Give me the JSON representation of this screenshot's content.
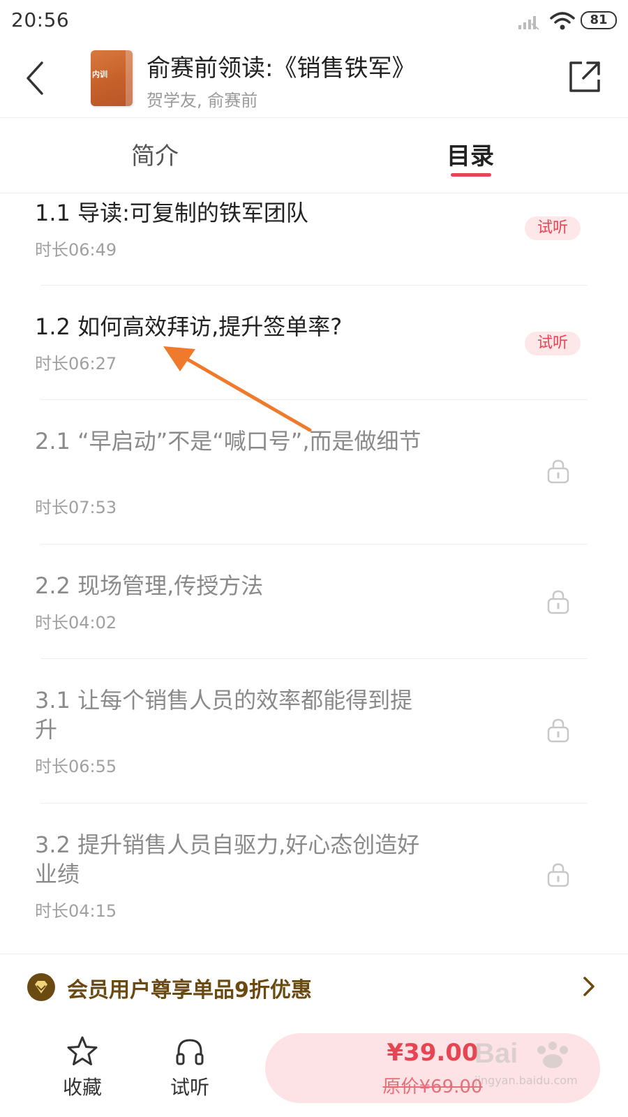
{
  "status_bar": {
    "time": "20:56",
    "battery": "81"
  },
  "header": {
    "back_icon": "chevron-left-icon",
    "cover_text": "内训",
    "title": "俞赛前领读:《销售铁军》",
    "subtitle": "贺学友, 俞赛前",
    "share_icon": "share-icon"
  },
  "tabs": [
    {
      "label": "简介",
      "active": false
    },
    {
      "label": "目录",
      "active": true
    }
  ],
  "accent_color": "#e64553",
  "chapters": [
    {
      "title": "1.1 导读:可复制的铁军团队",
      "duration": "时长06:49",
      "status": "试听"
    },
    {
      "title": "1.2 如何高效拜访,提升签单率?",
      "duration": "时长06:27",
      "status": "试听"
    },
    {
      "title": "2.1 “早启动”不是“喊口号”,而是做细节",
      "duration": "时长07:53",
      "status": "lock-icon"
    },
    {
      "title": "2.2 现场管理,传授方法",
      "duration": "时长04:02",
      "status": "lock-icon"
    },
    {
      "title": "3.1 让每个销售人员的效率都能得到提升",
      "duration": "时长06:55",
      "status": "lock-icon"
    },
    {
      "title": "3.2 提升销售人员自驱力,好心态创造好业绩",
      "duration": "时长04:15",
      "status": "lock-icon"
    }
  ],
  "member_banner": {
    "text": "会员用户尊享单品9折优惠",
    "icon": "vip-diamond-icon"
  },
  "bottom_bar": {
    "favorite_label": "收藏",
    "trial_label": "试听",
    "price": "¥39.00",
    "original_price": "原价¥69.00"
  },
  "watermark": {
    "text": "jingyan.baidu.com"
  }
}
